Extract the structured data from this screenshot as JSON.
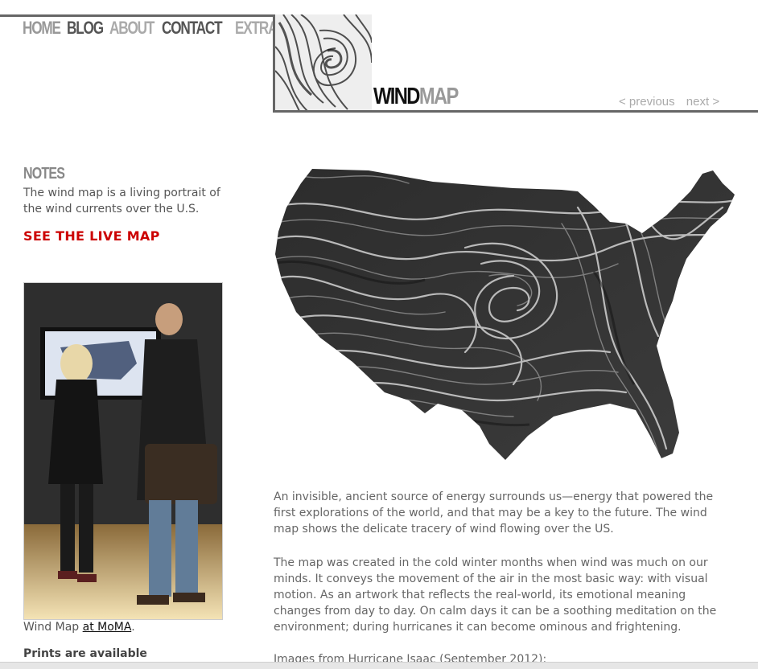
{
  "nav": [
    {
      "label": "HOME",
      "color": "#999999"
    },
    {
      "label": "BLOG",
      "color": "#555555"
    },
    {
      "label": "ABOUT",
      "color": "#aaaaaa"
    },
    {
      "label": "CONTACT",
      "color": "#555555"
    },
    {
      "label": "EXTRA",
      "color": "#aaaaaa"
    }
  ],
  "header": {
    "title_dark": "WIND",
    "title_light": "MAP",
    "prev": "< previous",
    "next": "next >"
  },
  "sidebar": {
    "notes_heading": "NOTES",
    "notes_text": "The wind map is a living portrait of the wind currents over the U.S.",
    "live_link": "SEE THE LIVE MAP",
    "caption_prefix": "Wind Map ",
    "caption_link": "at MoMA",
    "caption_suffix": ".",
    "prints": "Prints are available"
  },
  "main": {
    "paragraphs": [
      "An invisible, ancient source of energy surrounds us—energy that powered the first explorations of the world, and that may be a key to the future. The wind map shows the delicate tracery of wind flowing over the US.",
      "The map was created in the cold winter months when wind was much on our minds. It conveys the movement of the air in the most basic way: with visual motion. As an artwork that reflects the real-world, its emotional meaning changes from day to day. On calm days it can be a soothing meditation on the environment; during hurricanes it can become ominous and frightening.",
      "Images from Hurricane Isaac (September 2012):"
    ]
  },
  "colors": {
    "accent_red": "#cc0000",
    "rule": "#666666"
  }
}
